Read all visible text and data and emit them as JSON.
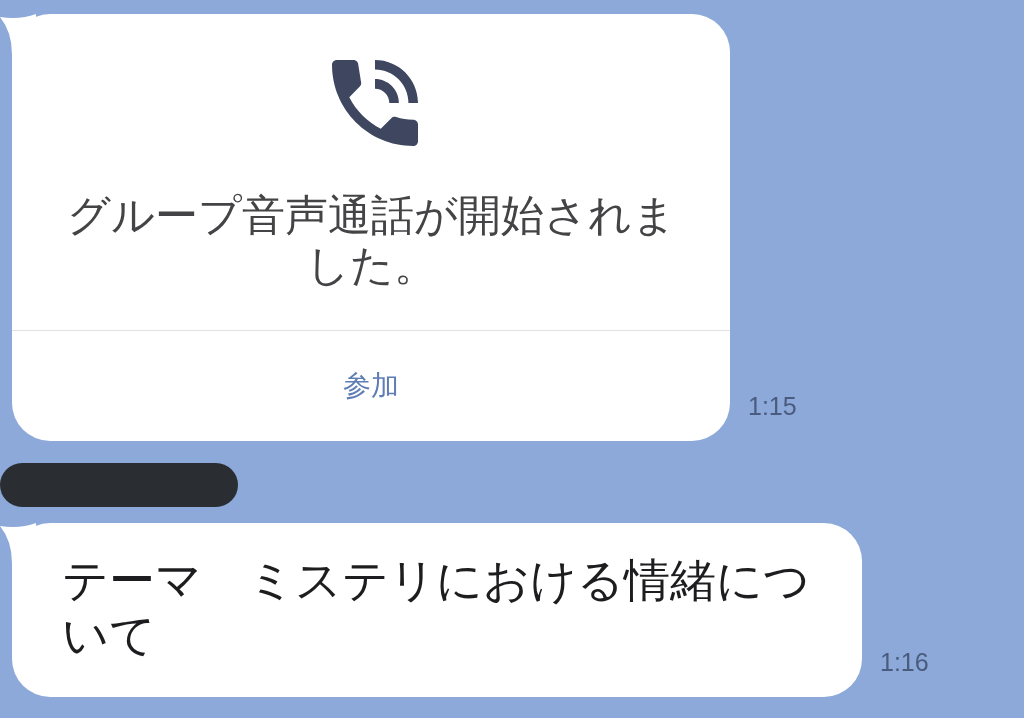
{
  "messages": [
    {
      "kind": "call",
      "sender_redacted": false,
      "text": "グループ音声通話が開始されました。",
      "action": "参加",
      "time": "1:15"
    },
    {
      "kind": "text",
      "sender_redacted": true,
      "text": "テーマ　ミステリにおける情緒について",
      "time": "1:16"
    }
  ]
}
